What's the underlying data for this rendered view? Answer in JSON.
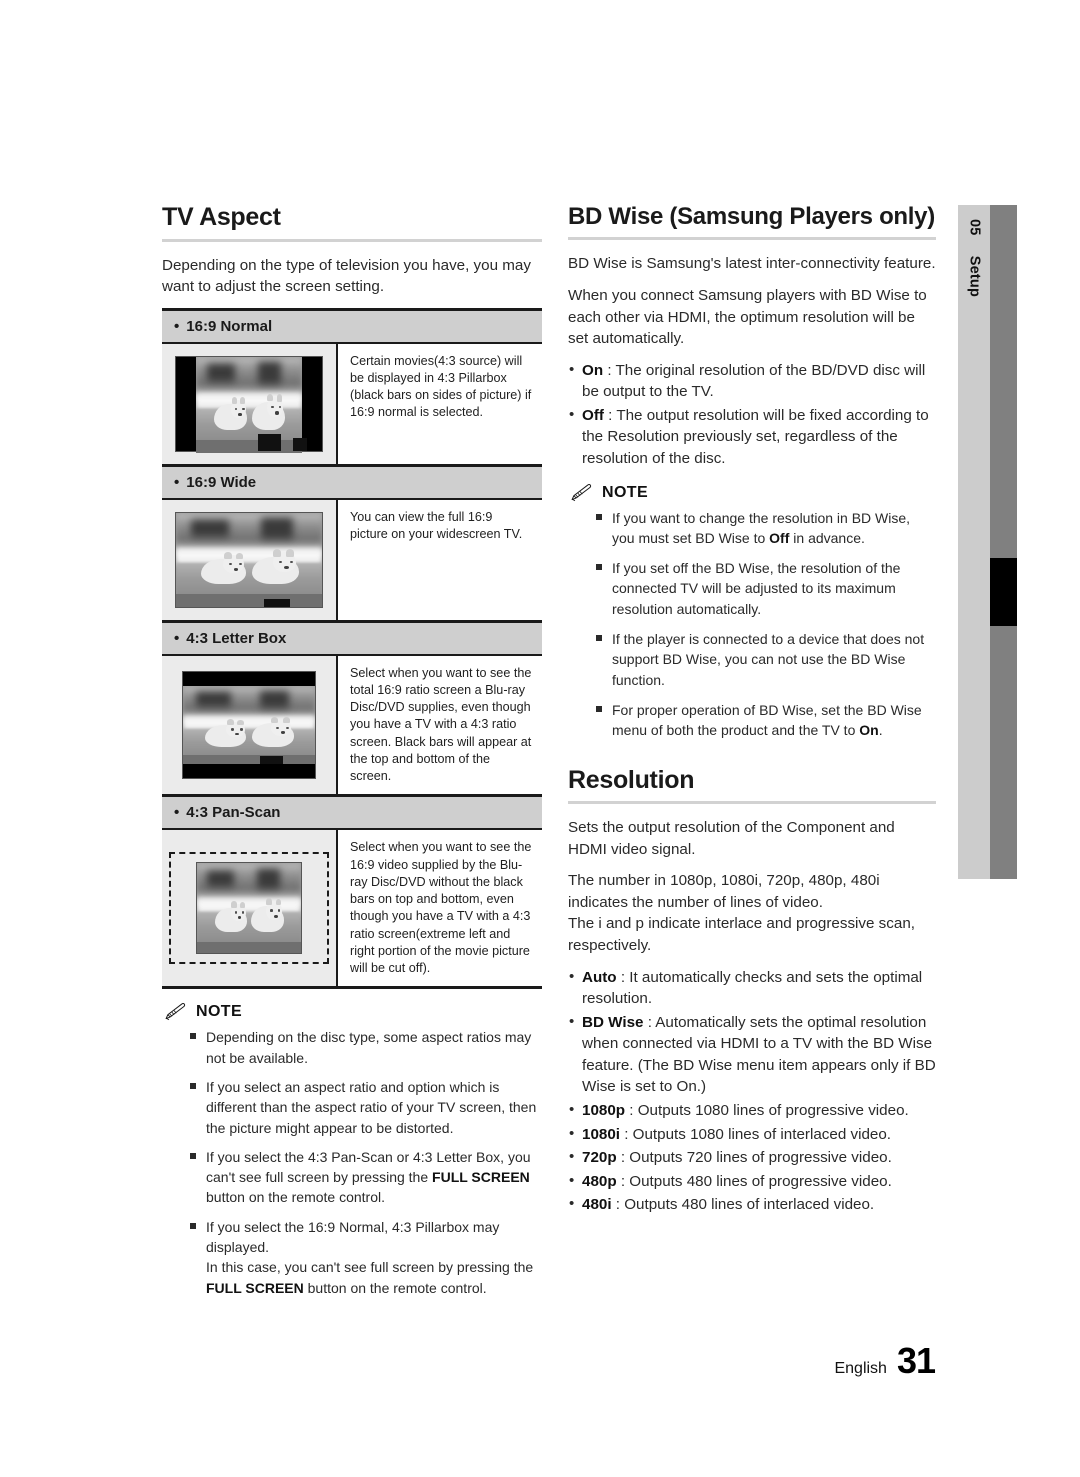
{
  "sidebar": {
    "chapter_number": "05",
    "chapter_label": "Setup"
  },
  "footer": {
    "language": "English",
    "page_number": "31"
  },
  "left_column": {
    "title": "TV Aspect",
    "intro": "Depending on the type of television you have, you may want to adjust the screen setting.",
    "table": [
      {
        "label": "16:9 Normal",
        "image": "pillarbox-puppies-photo",
        "description": "Certain movies(4:3 source) will be displayed in 4:3 Pillarbox (black bars on sides of picture) if 16:9 normal is selected."
      },
      {
        "label": "16:9 Wide",
        "image": "widescreen-puppies-photo",
        "description": "You can view the full 16:9 picture on your widescreen TV."
      },
      {
        "label": "4:3 Letter Box",
        "image": "letterbox-puppies-photo",
        "description": "Select when you want to see the total 16:9 ratio screen a Blu-ray Disc/DVD supplies, even though you have a TV with a 4:3 ratio screen. Black bars will appear at the top and bottom of the screen."
      },
      {
        "label": "4:3 Pan-Scan",
        "image": "panscan-puppies-photo",
        "description": "Select when you want to see the 16:9 video supplied by the Blu-ray Disc/DVD without the black bars on top and bottom, even though you have a TV with a 4:3 ratio screen(extreme left and right portion of the movie picture will be cut off)."
      }
    ],
    "note": {
      "label": "NOTE",
      "items": [
        {
          "parts": [
            {
              "t": "Depending on the disc type, some aspect ratios may not be available.",
              "bold": false
            }
          ]
        },
        {
          "parts": [
            {
              "t": "If you select an aspect ratio and option which is different than the aspect ratio of your TV screen, then the picture might appear to be distorted.",
              "bold": false
            }
          ]
        },
        {
          "parts": [
            {
              "t": "If you select the 4:3 Pan-Scan or 4:3 Letter Box, you can't see full screen by pressing the ",
              "bold": false
            },
            {
              "t": "FULL SCREEN",
              "bold": true
            },
            {
              "t": " button on the remote control.",
              "bold": false
            }
          ]
        },
        {
          "parts": [
            {
              "t": "If you select the 16:9 Normal, 4:3 Pillarbox may displayed.",
              "bold": false
            },
            {
              "t": "\nIn this case, you can't see full screen by pressing the ",
              "bold": false
            },
            {
              "t": "FULL SCREEN",
              "bold": true
            },
            {
              "t": " button on the remote control.",
              "bold": false
            }
          ]
        }
      ]
    }
  },
  "right_column": {
    "bdwise": {
      "title": "BD Wise (Samsung Players only)",
      "paragraphs": [
        "BD Wise is Samsung's latest inter-connectivity feature.",
        "When you connect Samsung players with BD Wise to each other via HDMI, the optimum resolution will be set automatically."
      ],
      "options": [
        {
          "term": "On",
          "desc": " : The original resolution of the BD/DVD disc will be output to the TV."
        },
        {
          "term": "Off",
          "desc": " : The output resolution will be fixed according to the Resolution previously set, regardless of the resolution of the disc."
        }
      ],
      "note": {
        "label": "NOTE",
        "items": [
          {
            "parts": [
              {
                "t": "If you want to change the resolution in BD Wise, you must set BD Wise to ",
                "bold": false
              },
              {
                "t": "Off",
                "bold": true
              },
              {
                "t": " in advance.",
                "bold": false
              }
            ]
          },
          {
            "parts": [
              {
                "t": "If you set off the BD Wise, the resolution of the connected TV will be adjusted to its maximum resolution automatically.",
                "bold": false
              }
            ]
          },
          {
            "parts": [
              {
                "t": "If the player is connected to a device that does not support BD Wise, you can not use the BD Wise function.",
                "bold": false
              }
            ]
          },
          {
            "parts": [
              {
                "t": "For proper operation of BD Wise, set the BD Wise menu of both the product and the TV to ",
                "bold": false
              },
              {
                "t": "On",
                "bold": true
              },
              {
                "t": ".",
                "bold": false
              }
            ]
          }
        ]
      }
    },
    "resolution": {
      "title": "Resolution",
      "paragraphs": [
        "Sets the output resolution of the Component and HDMI video signal.",
        "The number in 1080p, 1080i, 720p, 480p, 480i indicates the number of lines of video.\nThe i and p indicate interlace and progressive scan, respectively."
      ],
      "options": [
        {
          "term": "Auto",
          "desc": " : It automatically checks and sets the optimal resolution."
        },
        {
          "term": "BD Wise",
          "desc": " : Automatically sets the optimal resolution when connected via HDMI to a TV with the BD Wise feature. (The BD Wise menu item appears only if BD Wise is set to On.)"
        },
        {
          "term": "1080p",
          "desc": " : Outputs 1080 lines of progressive video."
        },
        {
          "term": "1080i",
          "desc": " : Outputs 1080 lines of interlaced video."
        },
        {
          "term": "720p",
          "desc": " : Outputs 720 lines of progressive video."
        },
        {
          "term": "480p",
          "desc": " : Outputs 480 lines of progressive video."
        },
        {
          "term": "480i",
          "desc": " : Outputs 480 lines of interlaced video."
        }
      ]
    }
  }
}
